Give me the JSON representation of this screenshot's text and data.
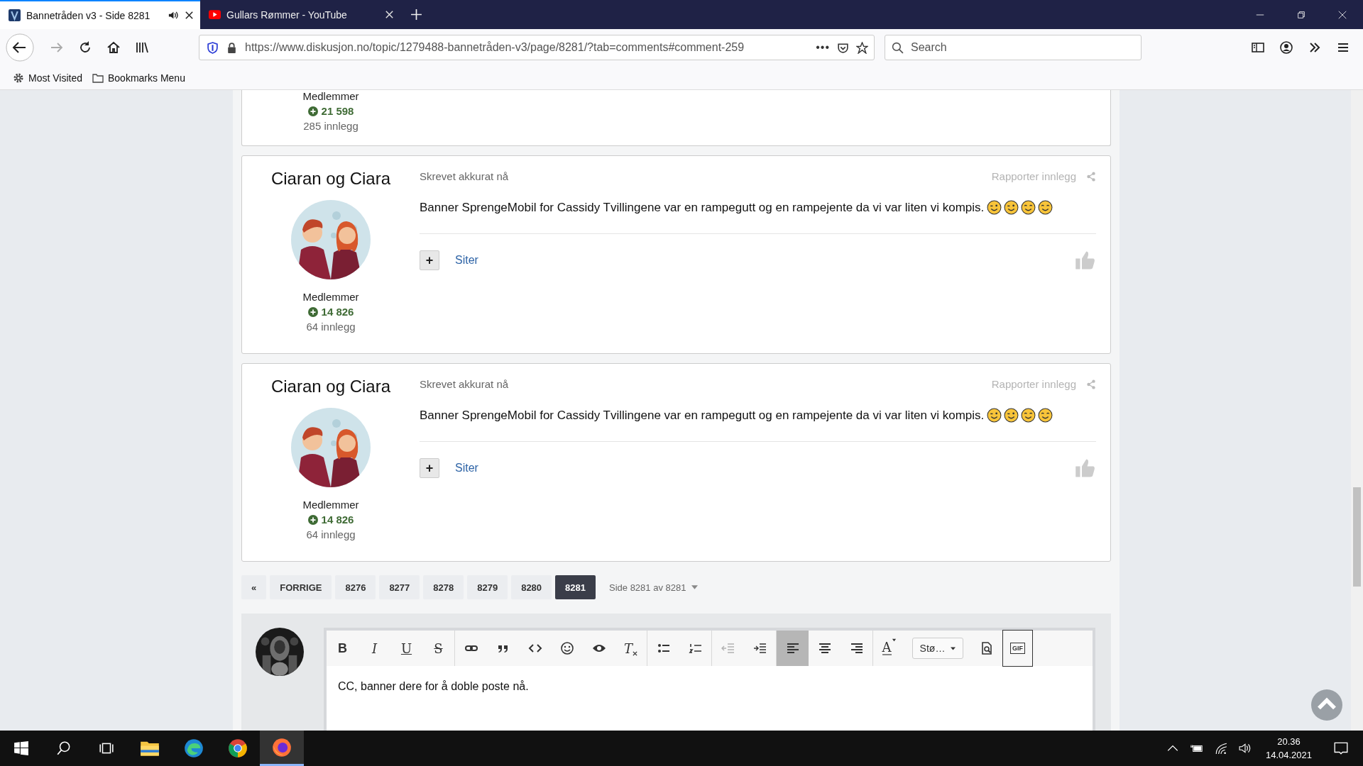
{
  "browser": {
    "tabs": [
      {
        "title": "Bannetråden v3 - Side 8281",
        "selected": true,
        "audio": true
      },
      {
        "title": "Gullars Rømmer - YouTube",
        "selected": false,
        "audio": false
      }
    ],
    "url": "https://www.diskusjon.no/topic/1279488-bannetråden-v3/page/8281/?tab=comments#comment-259",
    "page_actions": "•••",
    "search_placeholder": "Search",
    "bookmarks": [
      "Most Visited",
      "Bookmarks Menu"
    ]
  },
  "partial_post": {
    "group": "Medlemmer",
    "reputation": "21 598",
    "post_count": "285 innlegg"
  },
  "posts": [
    {
      "author": "Ciaran og Ciara",
      "group": "Medlemmer",
      "reputation": "14 826",
      "post_count": "64 innlegg",
      "time": "Skrevet akkurat nå",
      "report": "Rapporter innlegg",
      "body": "Banner SprengeMobil for Cassidy Tvillingene var en rampegutt og en rampejente da vi var liten vi kompis.",
      "emojis": [
        {
          "kind": "wink"
        },
        {
          "kind": "wink"
        },
        {
          "kind": "smile"
        },
        {
          "kind": "smile"
        }
      ],
      "multiquote": "+",
      "quote": "Siter"
    },
    {
      "author": "Ciaran og Ciara",
      "group": "Medlemmer",
      "reputation": "14 826",
      "post_count": "64 innlegg",
      "time": "Skrevet akkurat nå",
      "report": "Rapporter innlegg",
      "body": "Banner SprengeMobil for Cassidy Tvillingene var en rampegutt og en rampejente da vi var liten vi kompis.",
      "emojis": [
        {
          "kind": "wink"
        },
        {
          "kind": "wink"
        },
        {
          "kind": "smile"
        },
        {
          "kind": "smile"
        }
      ],
      "multiquote": "+",
      "quote": "Siter"
    }
  ],
  "pagination": {
    "first": "«",
    "prev": "FORRIGE",
    "pages": [
      {
        "label": "8276",
        "selected": false
      },
      {
        "label": "8277",
        "selected": false
      },
      {
        "label": "8278",
        "selected": false
      },
      {
        "label": "8279",
        "selected": false
      },
      {
        "label": "8280",
        "selected": false
      },
      {
        "label": "8281",
        "selected": true
      }
    ],
    "page_menu": "Side 8281 av 8281"
  },
  "editor": {
    "toolbar": [
      [
        {
          "kind": "bold",
          "label": "B",
          "active": false,
          "disabled": false
        },
        {
          "kind": "italic",
          "label": "I",
          "active": false,
          "disabled": false
        },
        {
          "kind": "underline",
          "label": "U",
          "active": false,
          "disabled": false
        },
        {
          "kind": "strike",
          "label": "S",
          "active": false,
          "disabled": false
        }
      ],
      [
        {
          "kind": "link",
          "active": false,
          "disabled": false
        },
        {
          "kind": "quote",
          "active": false,
          "disabled": false
        },
        {
          "kind": "code",
          "active": false,
          "disabled": false
        },
        {
          "kind": "emoji",
          "active": false,
          "disabled": false
        },
        {
          "kind": "spoiler",
          "active": false,
          "disabled": false
        },
        {
          "kind": "clear",
          "label": "T",
          "active": false,
          "disabled": false
        }
      ],
      [
        {
          "kind": "bullets",
          "active": false,
          "disabled": false
        },
        {
          "kind": "numbers",
          "active": false,
          "disabled": false
        }
      ],
      [
        {
          "kind": "outdent",
          "active": false,
          "disabled": true
        },
        {
          "kind": "indent",
          "active": false,
          "disabled": false
        }
      ],
      [
        {
          "kind": "align-left",
          "active": true,
          "disabled": false
        },
        {
          "kind": "align-center",
          "active": false,
          "disabled": false
        },
        {
          "kind": "align-right",
          "active": false,
          "disabled": false
        }
      ],
      [
        {
          "kind": "text-color",
          "label": "A",
          "active": false,
          "disabled": false
        },
        {
          "kind": "font-size",
          "label": "Stø…",
          "active": false,
          "disabled": false
        },
        {
          "kind": "preview",
          "active": false,
          "disabled": false
        },
        {
          "kind": "gif",
          "label": "GIF",
          "active": false,
          "disabled": false
        }
      ]
    ],
    "text": "CC, banner dere for å doble poste nå."
  },
  "taskbar": {
    "apps": [
      {
        "selected": false
      },
      {
        "selected": false
      },
      {
        "selected": false
      },
      {
        "selected": true
      }
    ],
    "time": "20.36",
    "date": "14.04.2021"
  }
}
